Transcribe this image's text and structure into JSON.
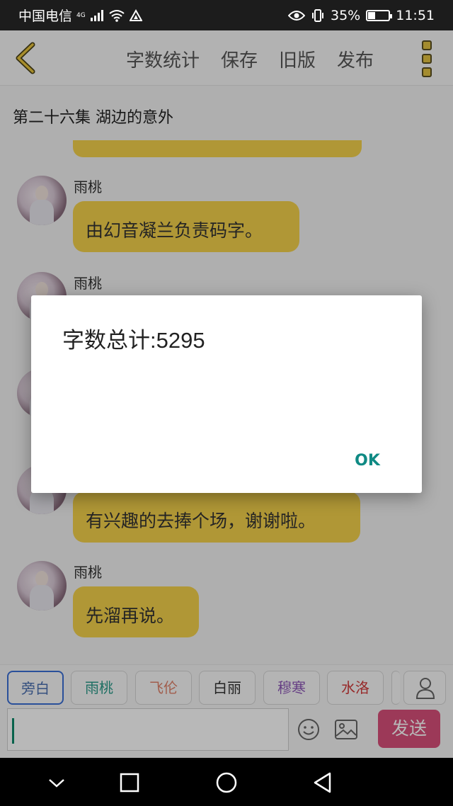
{
  "status_bar": {
    "carrier": "中国电信",
    "network": "4G",
    "battery": "35%",
    "battery_level": 0.35,
    "time": "11:51"
  },
  "header": {
    "actions": [
      "字数统计",
      "保存",
      "旧版",
      "发布"
    ]
  },
  "chapter_title": "第二十六集 湖边的意外",
  "messages": [
    {
      "name": "雨桃",
      "text": "由幻音凝兰负责码字。"
    },
    {
      "name": "雨桃",
      "text": ""
    },
    {
      "name": "雨桃",
      "text": ""
    },
    {
      "name": "雨桃",
      "text": "有兴趣的去捧个场，谢谢啦。"
    },
    {
      "name": "雨桃",
      "text": "先溜再说。"
    }
  ],
  "characters": [
    {
      "label": "旁白",
      "color": "#4a6fb0"
    },
    {
      "label": "雨桃",
      "color": "#2a9a8a"
    },
    {
      "label": "飞伦",
      "color": "#e0826a"
    },
    {
      "label": "白丽",
      "color": "#333333"
    },
    {
      "label": "穆寒",
      "color": "#8e58b8"
    },
    {
      "label": "水洛",
      "color": "#d23a3a"
    }
  ],
  "input": {
    "value": ""
  },
  "send_label": "发送",
  "dialog": {
    "message": "字数总计:5295",
    "ok_label": "OK"
  },
  "colors": {
    "bubble": "#f4d14c",
    "send": "#d9507a",
    "dialog_button": "#0f8a84"
  }
}
